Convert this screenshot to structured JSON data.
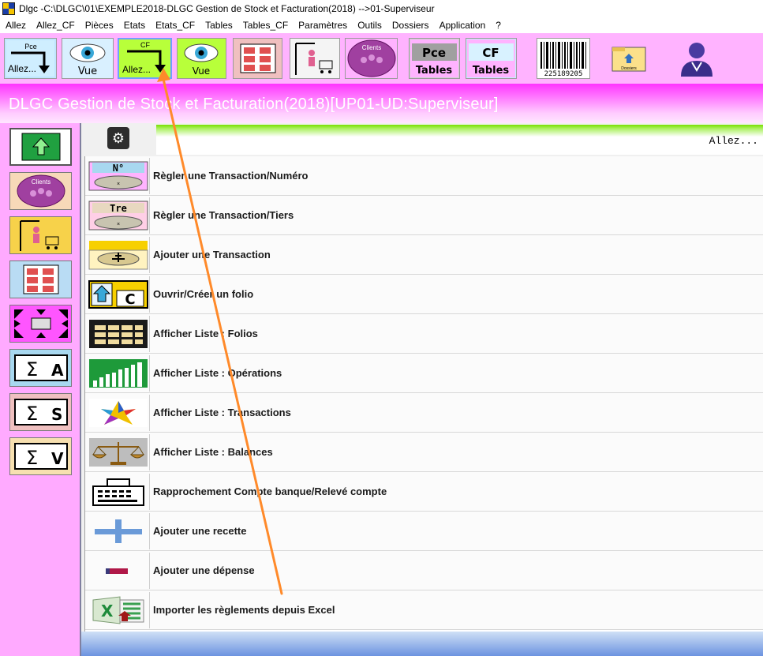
{
  "window": {
    "title": "Dlgc -C:\\DLGC\\01\\EXEMPLE2018-DLGC Gestion de Stock et Facturation(2018) -->01-Superviseur"
  },
  "menu": [
    "Allez",
    "Allez_CF",
    "Pièces",
    "Etats",
    "Etats_CF",
    "Tables",
    "Tables_CF",
    "Paramètres",
    "Outils",
    "Dossiers",
    "Application",
    "?"
  ],
  "toolbar": {
    "pce_allez": {
      "top": "Pce",
      "label": "Allez..."
    },
    "vue1": "Vue",
    "cf_allez": {
      "top": "CF",
      "label": "Allez..."
    },
    "vue2": "Vue",
    "clients": "Clients",
    "pce_tables": {
      "top": "Pce",
      "label": "Tables"
    },
    "cf_tables": {
      "top": "CF",
      "label": "Tables"
    },
    "barcode": "225189205",
    "dossiers": "Dossiers"
  },
  "banner": {
    "title": "DLGC Gestion de Stock et Facturation(2018)[UP01-UD:Superviseur]"
  },
  "sidebar": {
    "clients": "Clients",
    "sigma": [
      "A",
      "S",
      "V"
    ]
  },
  "main": {
    "allez_label": "Allez...",
    "items": [
      {
        "label": "Règler une Transaction/Numéro",
        "icon": "numero-coin-icon",
        "tag": "N°"
      },
      {
        "label": "Règler une Transaction/Tiers",
        "icon": "tiers-coin-icon",
        "tag": "Tre"
      },
      {
        "label": "Ajouter une Transaction",
        "icon": "add-transaction-icon"
      },
      {
        "label": "Ouvrir/Créer un folio",
        "icon": "folio-icon",
        "tag": "C"
      },
      {
        "label": "Afficher Liste : Folios",
        "icon": "folio-grid-icon"
      },
      {
        "label": "Afficher Liste : Opérations",
        "icon": "bar-chart-icon"
      },
      {
        "label": "Afficher Liste : Transactions",
        "icon": "star-icon"
      },
      {
        "label": "Afficher Liste : Balances",
        "icon": "scales-icon"
      },
      {
        "label": "Rapprochement Compte banque/Relevé compte",
        "icon": "cash-register-icon"
      },
      {
        "label": "Ajouter une recette",
        "icon": "plus-icon"
      },
      {
        "label": "Ajouter une dépense",
        "icon": "minus-icon"
      },
      {
        "label": "Importer les règlements depuis Excel",
        "icon": "excel-icon"
      }
    ]
  },
  "colors": {
    "toolbar_bg": "#ffb3ff",
    "banner": "#ff33ff",
    "accent_green": "#78e000",
    "arrow": "#ff8a2a"
  }
}
